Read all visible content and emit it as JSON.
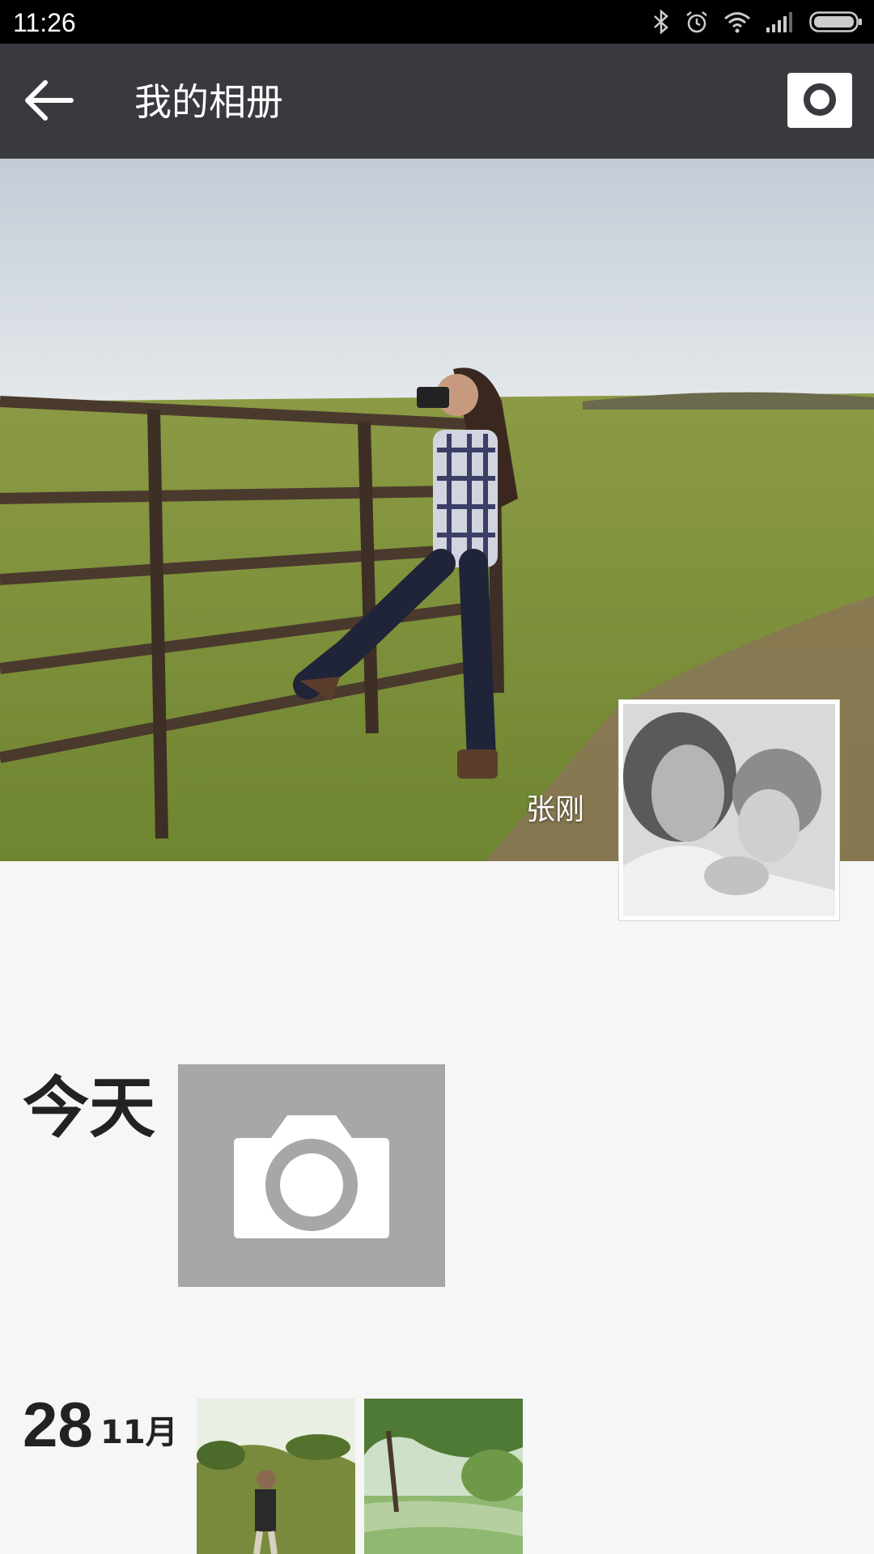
{
  "status_bar": {
    "time": "11:26",
    "icons": [
      "bluetooth-icon",
      "alarm-icon",
      "wifi-icon",
      "signal-icon",
      "battery-icon"
    ]
  },
  "app_bar": {
    "back_icon": "arrow-left-icon",
    "title": "我的相册",
    "camera_icon": "camera-icon",
    "background_color": "#393a3f"
  },
  "profile": {
    "user_name": "张刚"
  },
  "timeline": {
    "today": {
      "label": "今天",
      "add_photo_icon": "camera-icon"
    },
    "entries": [
      {
        "day": "28",
        "month": "11月",
        "thumbnails": [
          "golf-course-photo",
          "lake-trees-photo"
        ]
      }
    ]
  }
}
